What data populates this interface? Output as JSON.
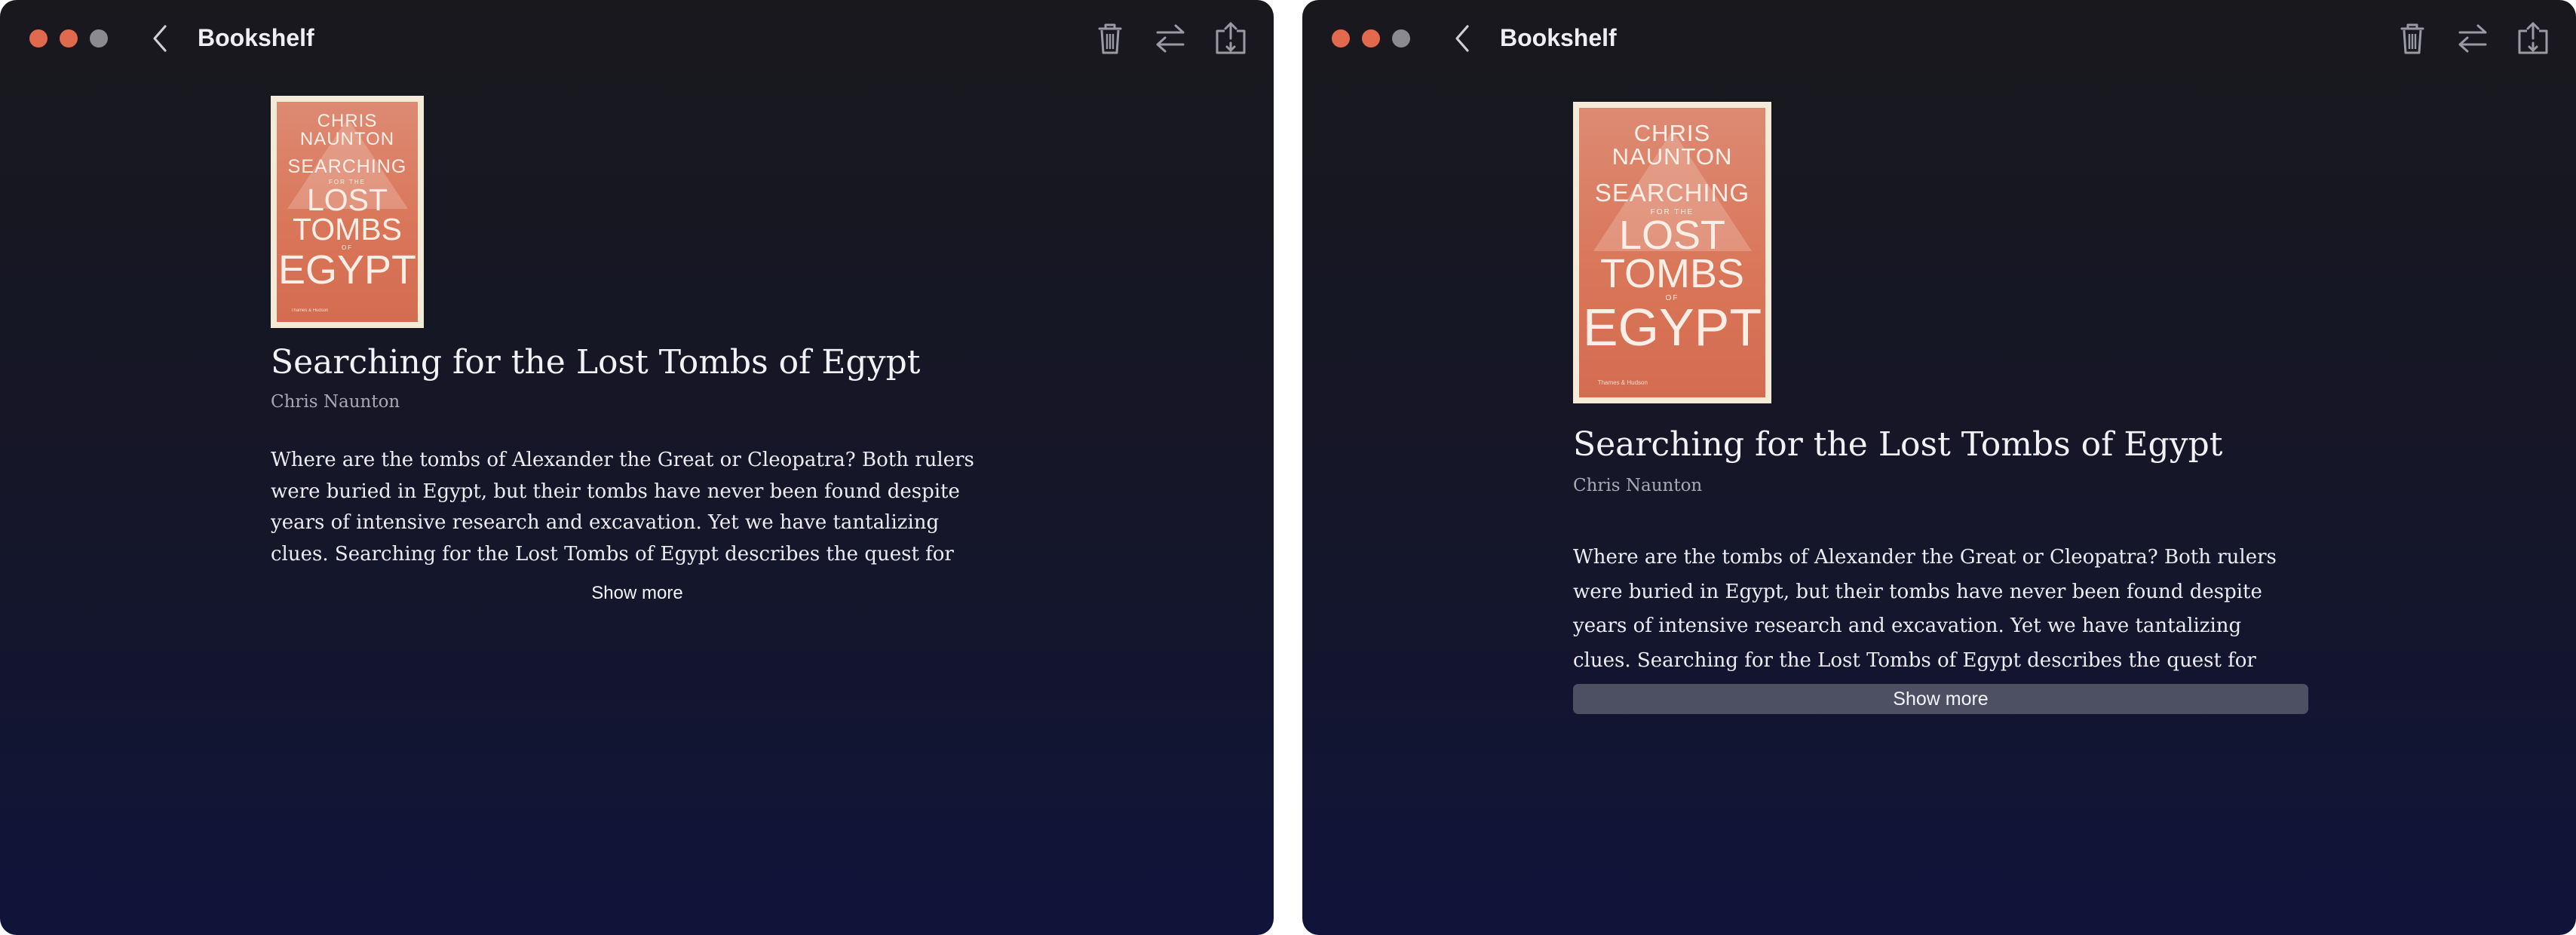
{
  "window": {
    "title": "Bookshelf",
    "toolbar_icons": [
      "trash-icon",
      "swap-icon",
      "share-icon"
    ]
  },
  "book": {
    "title": "Searching for the Lost Tombs of Egypt",
    "author": "Chris Naunton",
    "description": "Where are the tombs of Alexander the Great or Cleopatra? Both rulers were buried in Egypt, but their tombs have never been found despite years of intensive research and excavation. Yet we have tantalizing clues. Searching for the Lost Tombs of Egypt describes the quest for these and other great",
    "show_more_label": "Show more",
    "cover": {
      "author_line1": "CHRIS",
      "author_line2": "NAUNTON",
      "searching": "SEARCHING",
      "for_the": "FOR THE",
      "lost": "LOST",
      "tombs": "TOMBS",
      "of": "OF",
      "egypt": "EGYPT",
      "publisher": "Thames & Hudson"
    }
  },
  "colors": {
    "close": "#e0694e",
    "minimize": "#e0694e",
    "zoom": "#8a8a8f",
    "cover_orange": "#d97558",
    "hover_button": "#4d4f62"
  }
}
